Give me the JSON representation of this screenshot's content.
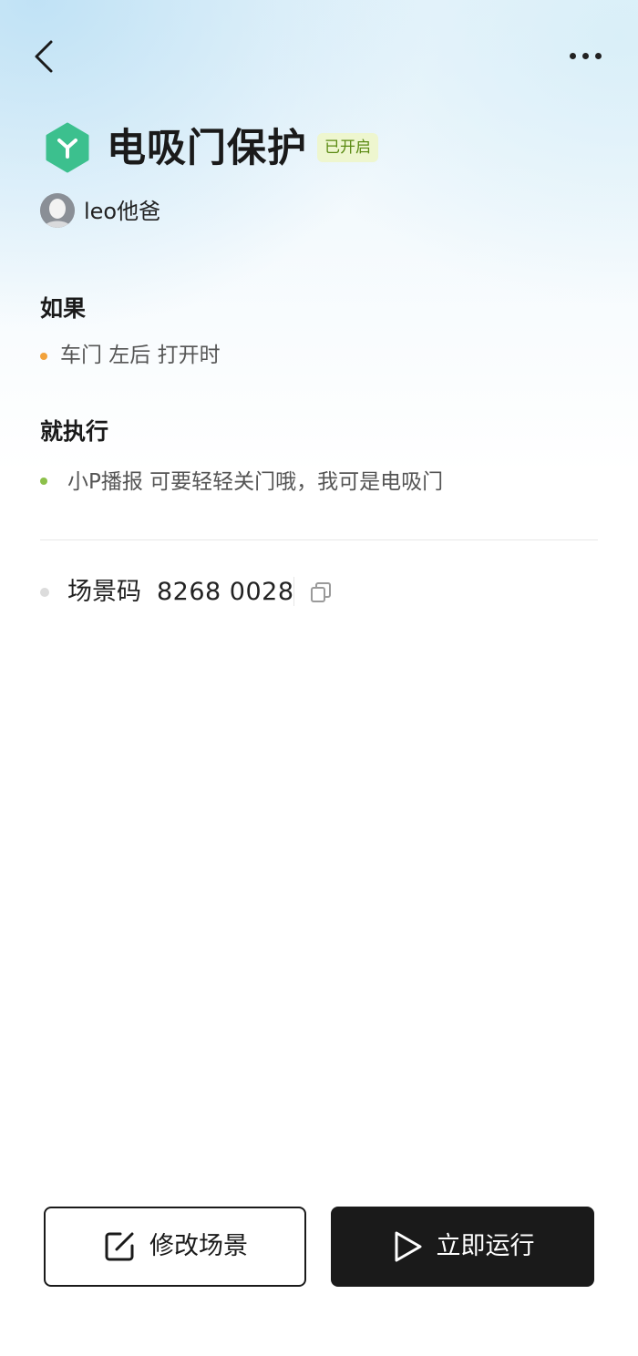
{
  "nav": {
    "back_icon": "chevron-left-icon",
    "more_icon": "more-horizontal-icon"
  },
  "scene": {
    "icon": "scene-hexagon-icon",
    "icon_color": "#3cc08e",
    "title": "电吸门保护",
    "status_badge": "已开启",
    "author": "leo他爸"
  },
  "condition": {
    "heading": "如果",
    "text": "车门 左后 打开时"
  },
  "action": {
    "heading": "就执行",
    "text": "小P播报 可要轻轻关门哦，我可是电吸门"
  },
  "scene_code": {
    "label": "场景码",
    "value": "8268 0028",
    "copy_icon": "copy-icon"
  },
  "buttons": {
    "edit_label": "修改场景",
    "edit_icon": "edit-icon",
    "run_label": "立即运行",
    "run_icon": "play-icon"
  },
  "colors": {
    "badge_bg": "#eef6cf",
    "badge_text": "#5a8a12",
    "condition_dot": "#f2a23c",
    "action_dot": "#8cc04a",
    "primary_button": "#1a1a1a"
  }
}
